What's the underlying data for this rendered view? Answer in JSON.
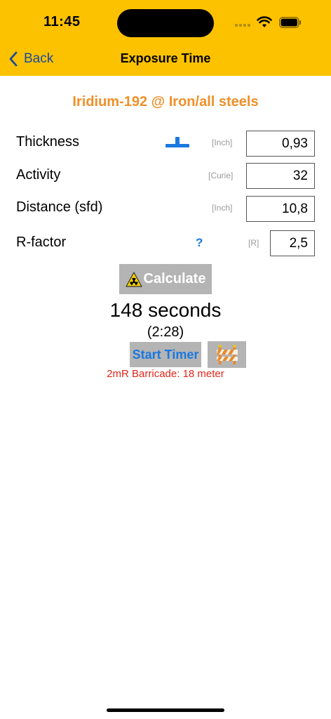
{
  "status_bar": {
    "time": "11:45"
  },
  "nav": {
    "back_label": "Back",
    "title": "Exposure Time"
  },
  "subtitle": "Iridium-192 @ Iron/all steels",
  "rows": {
    "thickness": {
      "label": "Thickness",
      "unit": "[Inch]",
      "value": "0,93"
    },
    "activity": {
      "label": "Activity",
      "unit": "[Curie]",
      "value": "32"
    },
    "distance": {
      "label": "Distance (sfd)",
      "unit": "[Inch]",
      "value": "10,8"
    },
    "rfactor": {
      "label": "R-factor",
      "help": "?",
      "unit": "[R]",
      "value": "2,5"
    }
  },
  "actions": {
    "calculate_label": "Calculate",
    "start_timer_label": "Start Timer"
  },
  "result": {
    "seconds": "148 seconds",
    "formatted": "(2:28)",
    "barricade": "2mR Barricade: 18 meter"
  },
  "colors": {
    "header": "#FCC200",
    "accent_orange": "#F0902A",
    "link_blue": "#1A78E0",
    "warning_red": "#E0261B",
    "button_gray": "#B4B4B4"
  },
  "icons": [
    "chevron-left-icon",
    "slider-icon",
    "radiation-icon",
    "barricade-icon",
    "wifi-icon",
    "battery-icon",
    "signal-icon"
  ]
}
